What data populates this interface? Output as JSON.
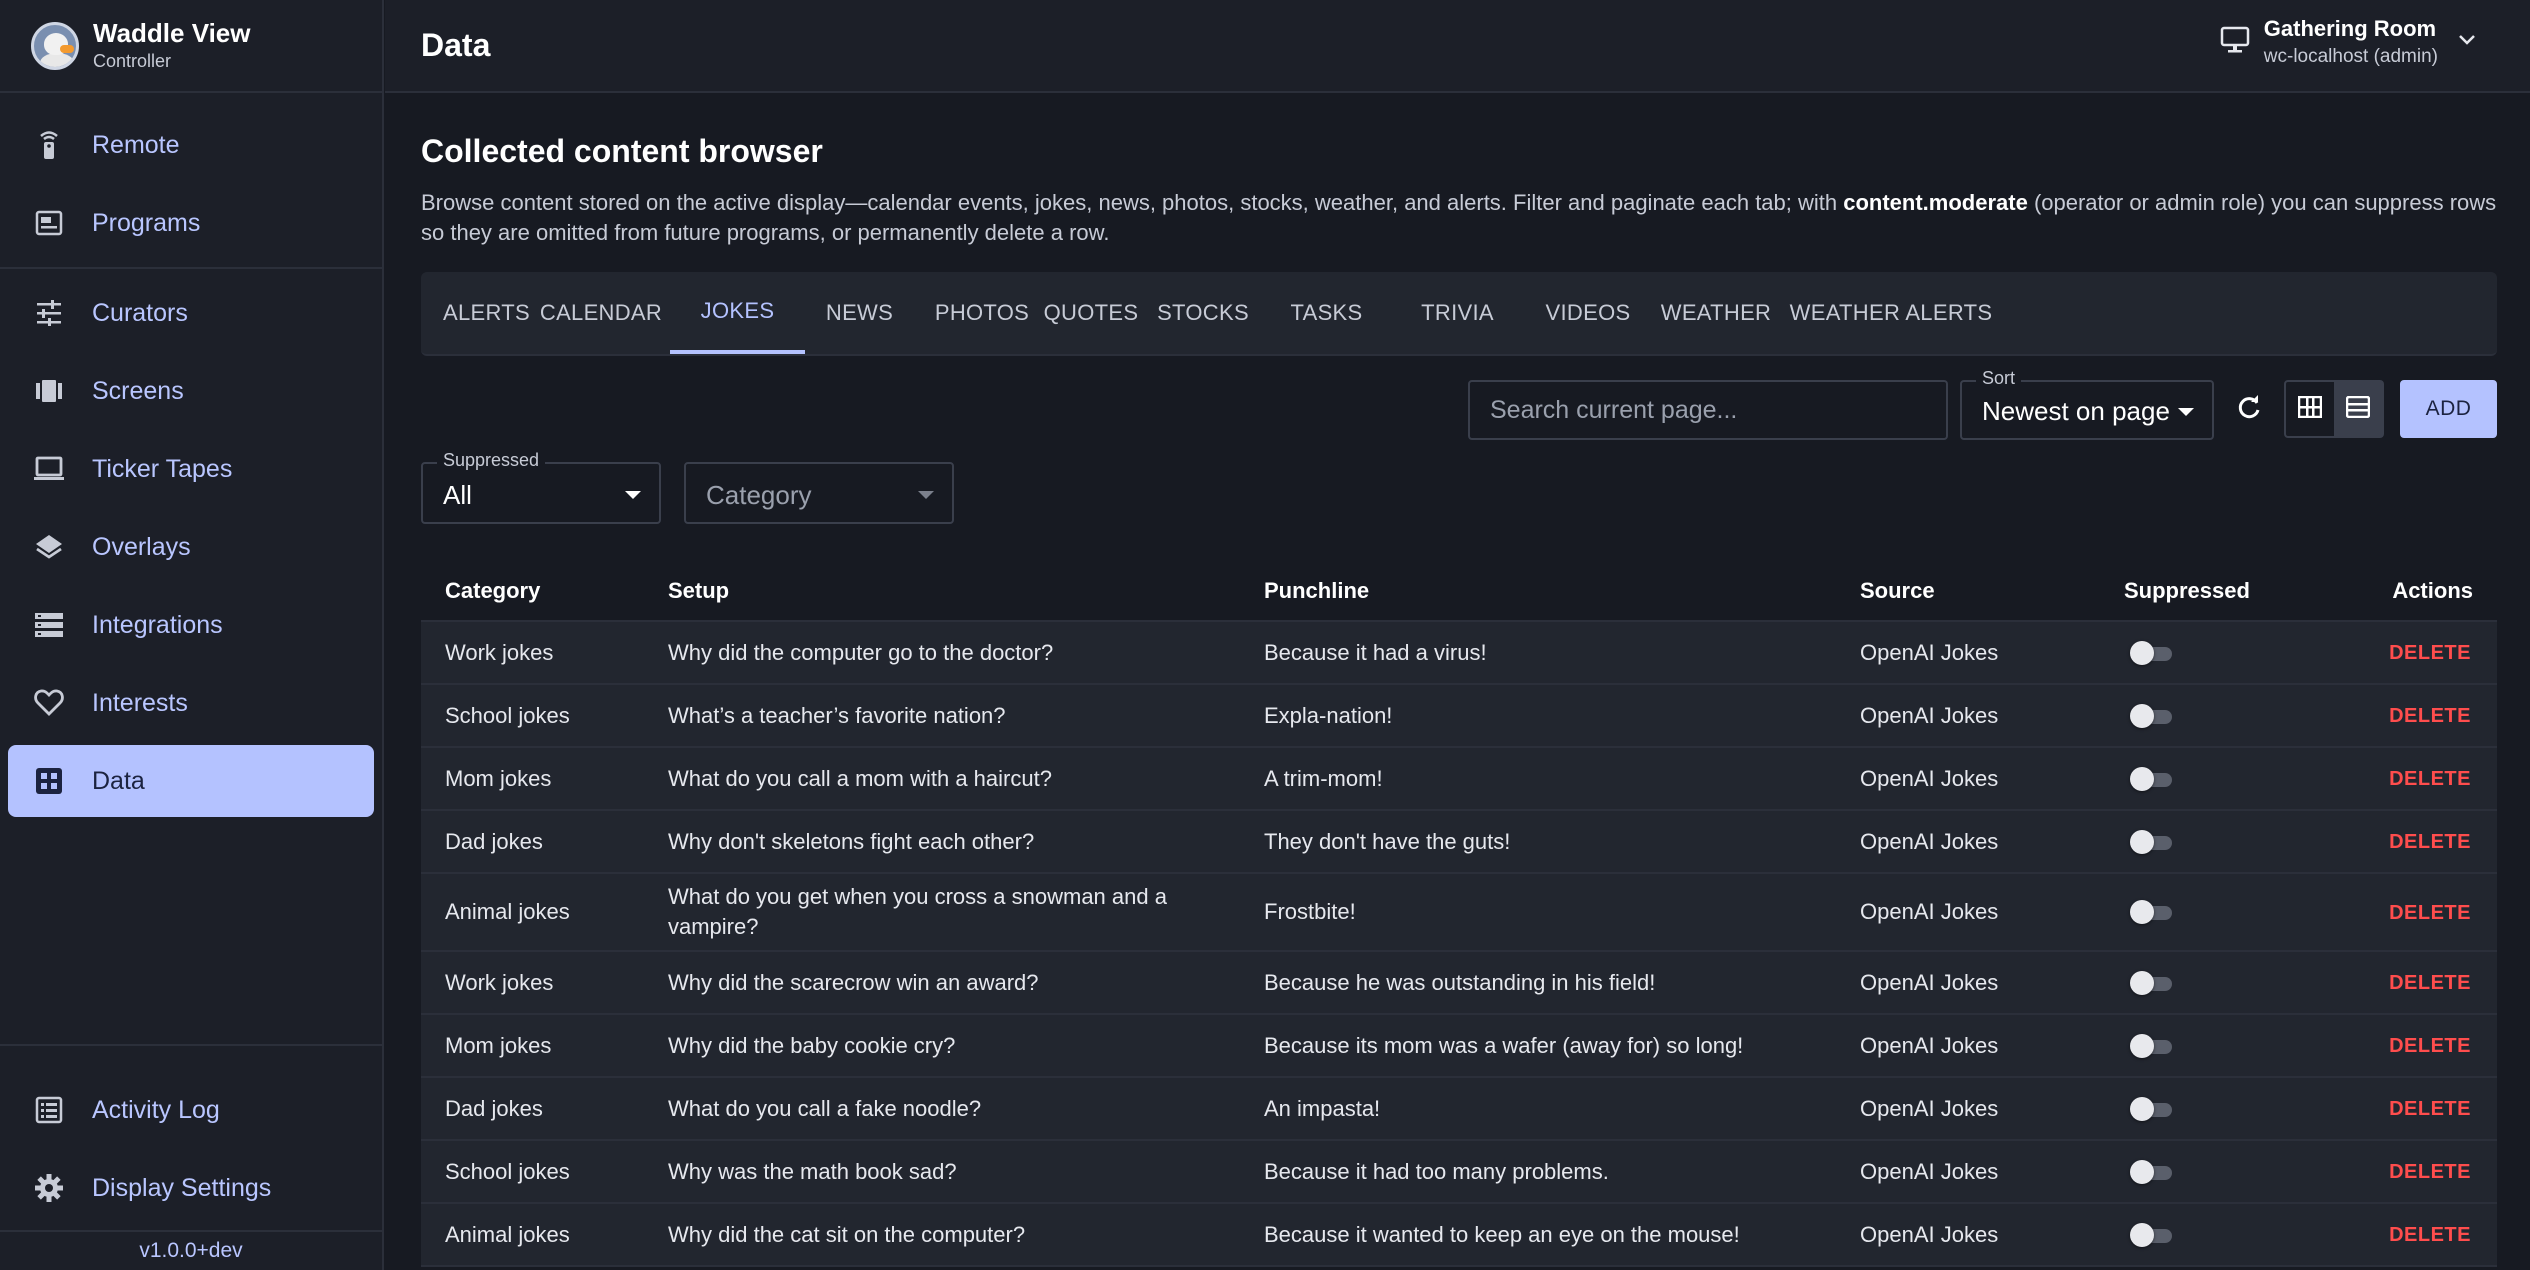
{
  "app": {
    "title": "Waddle View",
    "subtitle": "Controller",
    "version": "v1.0.0+dev"
  },
  "sidebar": {
    "items": [
      {
        "label": "Remote",
        "icon": "remote-icon"
      },
      {
        "label": "Programs",
        "icon": "programs-icon"
      },
      {
        "label": "Curators",
        "icon": "tune-icon"
      },
      {
        "label": "Screens",
        "icon": "screens-icon"
      },
      {
        "label": "Ticker Tapes",
        "icon": "monitor-icon"
      },
      {
        "label": "Overlays",
        "icon": "layers-icon"
      },
      {
        "label": "Integrations",
        "icon": "storage-icon"
      },
      {
        "label": "Interests",
        "icon": "heart-icon"
      },
      {
        "label": "Data",
        "icon": "dashboard-icon",
        "active": true
      }
    ],
    "bottom": [
      {
        "label": "Activity Log",
        "icon": "list-icon"
      },
      {
        "label": "Display Settings",
        "icon": "gear-icon"
      }
    ]
  },
  "header": {
    "title": "Data",
    "display_name": "Gathering Room",
    "display_host": "wc-localhost (admin)"
  },
  "main": {
    "heading": "Collected content browser",
    "desc_part1": "Browse content stored on the active display—calendar events, jokes, news, photos, stocks, weather, and alerts. Filter and paginate each tab; with ",
    "desc_bold": "content.moderate",
    "desc_part2": " (operator or admin role) you can suppress rows so they are omitted from future programs, or permanently delete a row.",
    "tabs": [
      "ALERTS",
      "CALENDAR",
      "JOKES",
      "NEWS",
      "PHOTOS",
      "QUOTES",
      "STOCKS",
      "TASKS",
      "TRIVIA",
      "VIDEOS",
      "WEATHER",
      "WEATHER ALERTS"
    ],
    "active_tab": "JOKES"
  },
  "toolbar": {
    "search_placeholder": "Search current page...",
    "sort_label": "Sort",
    "sort_value": "Newest on page",
    "add_label": "ADD"
  },
  "filters": {
    "suppressed_label": "Suppressed",
    "suppressed_value": "All",
    "category_placeholder": "Category"
  },
  "table": {
    "headers": [
      "Category",
      "Setup",
      "Punchline",
      "Source",
      "Suppressed",
      "Actions"
    ],
    "delete_label": "DELETE",
    "rows": [
      {
        "category": "Work jokes",
        "setup": "Why did the computer go to the doctor?",
        "punchline": "Because it had a virus!",
        "source": "OpenAI Jokes",
        "suppressed": false
      },
      {
        "category": "School jokes",
        "setup": "What’s a teacher’s favorite nation?",
        "punchline": "Expla-nation!",
        "source": "OpenAI Jokes",
        "suppressed": false
      },
      {
        "category": "Mom jokes",
        "setup": "What do you call a mom with a haircut?",
        "punchline": "A trim-mom!",
        "source": "OpenAI Jokes",
        "suppressed": false
      },
      {
        "category": "Dad jokes",
        "setup": "Why don't skeletons fight each other?",
        "punchline": "They don't have the guts!",
        "source": "OpenAI Jokes",
        "suppressed": false
      },
      {
        "category": "Animal jokes",
        "setup": "What do you get when you cross a snowman and a vampire?",
        "punchline": "Frostbite!",
        "source": "OpenAI Jokes",
        "suppressed": false
      },
      {
        "category": "Work jokes",
        "setup": "Why did the scarecrow win an award?",
        "punchline": "Because he was outstanding in his field!",
        "source": "OpenAI Jokes",
        "suppressed": false
      },
      {
        "category": "Mom jokes",
        "setup": "Why did the baby cookie cry?",
        "punchline": "Because its mom was a wafer (away for) so long!",
        "source": "OpenAI Jokes",
        "suppressed": false
      },
      {
        "category": "Dad jokes",
        "setup": "What do you call a fake noodle?",
        "punchline": "An impasta!",
        "source": "OpenAI Jokes",
        "suppressed": false
      },
      {
        "category": "School jokes",
        "setup": "Why was the math book sad?",
        "punchline": "Because it had too many problems.",
        "source": "OpenAI Jokes",
        "suppressed": false
      },
      {
        "category": "Animal jokes",
        "setup": "Why did the cat sit on the computer?",
        "punchline": "Because it wanted to keep an eye on the mouse!",
        "source": "OpenAI Jokes",
        "suppressed": false
      }
    ]
  },
  "colors": {
    "accent": "#b4c2ff",
    "danger": "#ff4d4d",
    "background": "#171a22",
    "surface": "#22262f"
  }
}
